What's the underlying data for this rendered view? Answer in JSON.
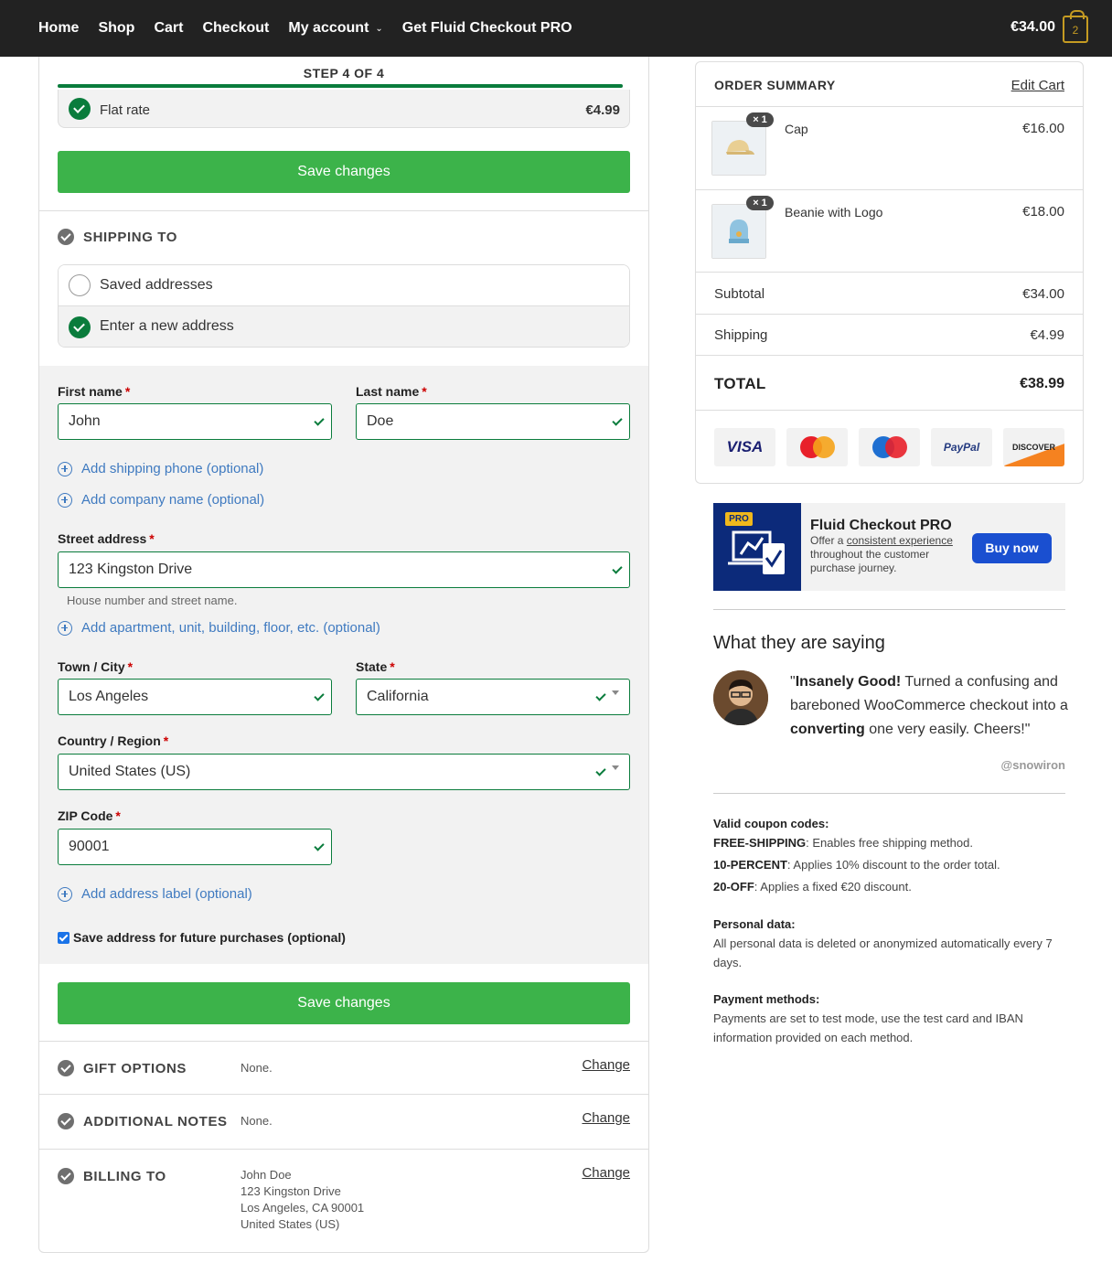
{
  "nav": {
    "items": [
      "Home",
      "Shop",
      "Cart",
      "Checkout",
      "My account",
      "Get Fluid Checkout PRO"
    ],
    "cart_total": "€34.00",
    "cart_count": "2"
  },
  "checkout": {
    "step_label": "STEP 4 OF 4",
    "progress_fraction": 1.0,
    "shipping_method": {
      "label": "Flat rate",
      "price": "€4.99"
    },
    "save_changes_label": "Save changes",
    "shipping_to": {
      "title": "SHIPPING TO",
      "options": [
        "Saved addresses",
        "Enter a new address"
      ]
    },
    "form": {
      "first_name": {
        "label": "First name",
        "value": "John"
      },
      "last_name": {
        "label": "Last name",
        "value": "Doe"
      },
      "add_phone": "Add shipping phone (optional)",
      "add_company": "Add company name (optional)",
      "street": {
        "label": "Street address",
        "value": "123 Kingston Drive",
        "hint": "House number and street name."
      },
      "add_apartment": "Add apartment, unit, building, floor, etc. (optional)",
      "city": {
        "label": "Town / City",
        "value": "Los Angeles"
      },
      "state": {
        "label": "State",
        "value": "California"
      },
      "country": {
        "label": "Country / Region",
        "value": "United States (US)"
      },
      "zip": {
        "label": "ZIP Code",
        "value": "90001"
      },
      "add_label": "Add address label (optional)",
      "save_address": "Save address for future purchases (optional)",
      "required_mark": "*"
    },
    "gift_options": {
      "title": "GIFT OPTIONS",
      "value": "None.",
      "change": "Change"
    },
    "additional_notes": {
      "title": "ADDITIONAL NOTES",
      "value": "None.",
      "change": "Change"
    },
    "billing_to": {
      "title": "BILLING TO",
      "lines": [
        "John Doe",
        "123 Kingston Drive",
        "Los Angeles, CA 90001",
        "United States (US)"
      ],
      "change": "Change"
    }
  },
  "order_summary": {
    "title": "ORDER SUMMARY",
    "edit_cart": "Edit Cart",
    "items": [
      {
        "name": "Cap",
        "qty": "× 1",
        "price": "€16.00"
      },
      {
        "name": "Beanie with Logo",
        "qty": "× 1",
        "price": "€18.00"
      }
    ],
    "subtotal": {
      "label": "Subtotal",
      "value": "€34.00"
    },
    "shipping": {
      "label": "Shipping",
      "value": "€4.99"
    },
    "total": {
      "label": "TOTAL",
      "value": "€38.99"
    },
    "payment_logos": [
      "VISA",
      "MasterCard",
      "Maestro",
      "PayPal",
      "DISCOVER"
    ]
  },
  "promo": {
    "tag": "PRO",
    "title": "Fluid Checkout PRO",
    "text_pre": "Offer a ",
    "text_link": "consistent experience",
    "text_post": " throughout the customer purchase journey.",
    "button": "Buy now"
  },
  "testimonial": {
    "title": "What they are saying",
    "quote_open": "\"",
    "quote_b1": "Insanely Good!",
    "quote_t1": " Turned a confusing and bareboned WooCommerce checkout into a ",
    "quote_b2": "converting",
    "quote_t2": " one very easily. Cheers!\"",
    "handle": "@snowiron"
  },
  "notes": {
    "coupons_title": "Valid coupon codes:",
    "coupons": [
      {
        "code": "FREE-SHIPPING",
        "desc": ": Enables free shipping method."
      },
      {
        "code": "10-PERCENT",
        "desc": ": Applies 10% discount to the order total."
      },
      {
        "code": "20-OFF",
        "desc": ": Applies a fixed €20 discount."
      }
    ],
    "personal_title": "Personal data:",
    "personal_text": "All personal data is deleted or anonymized automatically every 7 days.",
    "payment_title": "Payment methods:",
    "payment_text": "Payments are set to test mode, use the test card and IBAN information provided on each method."
  },
  "colors": {
    "topbar": "#222222",
    "accent_green": "#0a7c3c",
    "button_green": "#3cb34a",
    "link_blue": "#3f7ac0",
    "cart_gold": "#c59b22"
  }
}
